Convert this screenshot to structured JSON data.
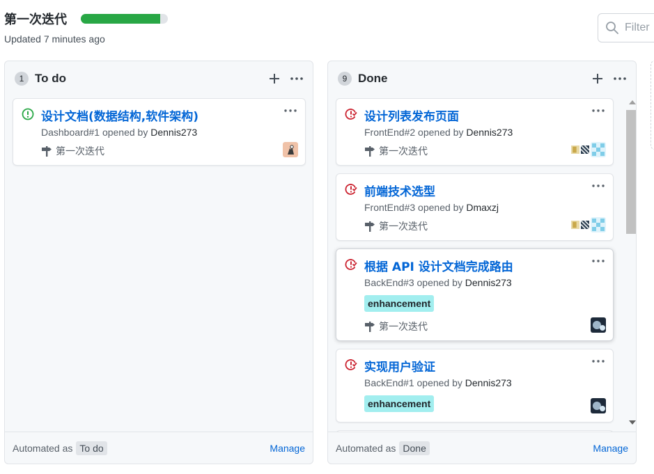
{
  "project": {
    "title": "第一次迭代",
    "progress_percent": 91,
    "updated": "Updated 7 minutes ago",
    "progress_color": "#28a745"
  },
  "filter": {
    "placeholder": "Filter",
    "icon": "search-icon"
  },
  "columns": [
    {
      "count": "1",
      "name": "To do",
      "automated_prefix": "Automated as",
      "automated_value": "To do",
      "manage": "Manage",
      "cards": [
        {
          "state": "open",
          "title": "设计文档(数据结构,软件架构)",
          "meta_prefix": "Dashboard#1 opened by",
          "meta_user": "Dennis273",
          "milestone": "第一次迭代",
          "avatars": [
            "avatar-1"
          ]
        }
      ]
    },
    {
      "count": "9",
      "name": "Done",
      "automated_prefix": "Automated as",
      "automated_value": "Done",
      "manage": "Manage",
      "cards": [
        {
          "state": "closed",
          "title": "设计列表发布页面",
          "meta_prefix": "FrontEnd#2 opened by",
          "meta_user": "Dennis273",
          "milestone": "第一次迭代",
          "avatars": [
            "avatar-2",
            "avatar-3",
            "avatar-4"
          ]
        },
        {
          "state": "closed",
          "title": "前端技术选型",
          "meta_prefix": "FrontEnd#3 opened by",
          "meta_user": "Dmaxzj",
          "milestone": "第一次迭代",
          "avatars": [
            "avatar-2",
            "avatar-3",
            "avatar-4"
          ]
        },
        {
          "state": "closed",
          "title": "根据 API 设计文档完成路由",
          "meta_prefix": "BackEnd#3 opened by",
          "meta_user": "Dennis273",
          "label": "enhancement",
          "milestone": "第一次迭代",
          "avatars": [
            "avatar-5"
          ]
        },
        {
          "state": "closed",
          "title": "实现用户验证",
          "meta_prefix": "BackEnd#1 opened by",
          "meta_user": "Dennis273",
          "label": "enhancement",
          "avatars": [
            "avatar-5"
          ]
        }
      ]
    }
  ],
  "colors": {
    "open_icon": "#28a745",
    "closed_icon": "#cb2431",
    "link": "#0366d6",
    "label_bg": "#a2eeef"
  }
}
